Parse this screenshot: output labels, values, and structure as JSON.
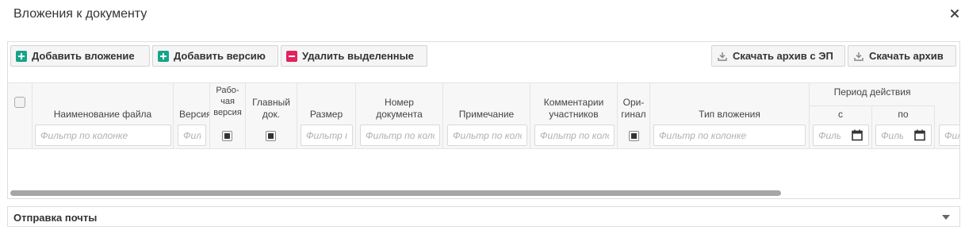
{
  "dialog": {
    "title": "Вложения к документу",
    "close_icon": "close-icon"
  },
  "toolbar": {
    "add_attachment": "Добавить вложение",
    "add_version": "Добавить версию",
    "delete_selected": "Удалить выделенные",
    "download_archive_ep": "Скачать архив с ЭП",
    "download_archive": "Скачать архив"
  },
  "columns": {
    "filename": "Наименование файла",
    "version": "Версия",
    "working_version_1": "Рабо-",
    "working_version_2": "чая",
    "working_version_3": "версия",
    "main_doc_1": "Главный",
    "main_doc_2": "док.",
    "size": "Размер",
    "doc_number_1": "Номер",
    "doc_number_2": "документа",
    "note": "Примечание",
    "comments_1": "Комментарии",
    "comments_2": "участников",
    "original_1": "Ори-",
    "original_2": "гинал",
    "attachment_type": "Тип вложения",
    "period": "Период действия",
    "period_from": "с",
    "period_to": "по"
  },
  "filters": {
    "placeholder": "Фильтр по колонке"
  },
  "sections": {
    "mail": "Отправка почты"
  },
  "colors": {
    "accent_green": "#17a589",
    "accent_red": "#e0245e"
  }
}
